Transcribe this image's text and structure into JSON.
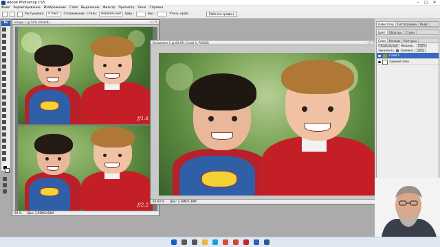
{
  "window": {
    "title": "Adobe Photoshop CS3",
    "controls": [
      "–",
      "□",
      "✕"
    ]
  },
  "menu": [
    "Файл",
    "Редактирование",
    "Изображение",
    "Слой",
    "Выделение",
    "Фильтр",
    "Просмотр",
    "Окно",
    "Справка"
  ],
  "options": {
    "feather_label": "Растушевка:",
    "feather_value": "0 пикс.",
    "antialias_label": "Сглаживание",
    "style_label": "Стиль:",
    "style_value": "Нормальный",
    "width_label": "Шир.:",
    "height_label": "Выс.:",
    "refine_label": "Уточн. край...",
    "workspace": "Рабочая среда ▾"
  },
  "toolbox": {
    "logo": "Ps"
  },
  "documents": {
    "left": {
      "title": "Image 1 @ 50% (RGB/8)",
      "zoom": "50 %",
      "docsize": "Док: 3,55М/3,55М",
      "watermark_top": "f/1.6",
      "watermark_bottom": "f/2.2"
    },
    "right": {
      "title": "Безымянн-1 @ 82,6% (Слой 1, RGB/8)",
      "zoom": "82,64 %",
      "docsize": "Док: 2,38М/2,38М"
    }
  },
  "panels": {
    "navigator_tabs": [
      "Навигатор",
      "Гистограмма",
      "Инфо"
    ],
    "color_tabs": [
      "Цвет",
      "Образцы",
      "Стили"
    ],
    "layers_tabs": [
      "Слои",
      "Каналы",
      "Контуры"
    ],
    "blend_mode": "Нормальный",
    "opacity_label": "Непрозр.:",
    "opacity_value": "100%",
    "lock_label": "Закрепить:",
    "fill_label": "Заливка:",
    "fill_value": "100%",
    "layers": [
      {
        "name": "Слой 1",
        "active": true
      },
      {
        "name": "Задний план",
        "active": false
      }
    ]
  },
  "taskbar": {
    "icons": [
      "start-icon",
      "search-icon",
      "taskview-icon",
      "explorer-icon",
      "edge-icon",
      "chrome-icon",
      "yandex-icon",
      "opera-icon",
      "photoshop-icon",
      "word-icon"
    ],
    "icon_colors": [
      "#0b63c5",
      "#5a5a5a",
      "#555555",
      "#e9b540",
      "#1c9fd8",
      "#d94a3a",
      "#e23b3b",
      "#c9242b",
      "#2a5eb8",
      "#2b579a"
    ]
  }
}
